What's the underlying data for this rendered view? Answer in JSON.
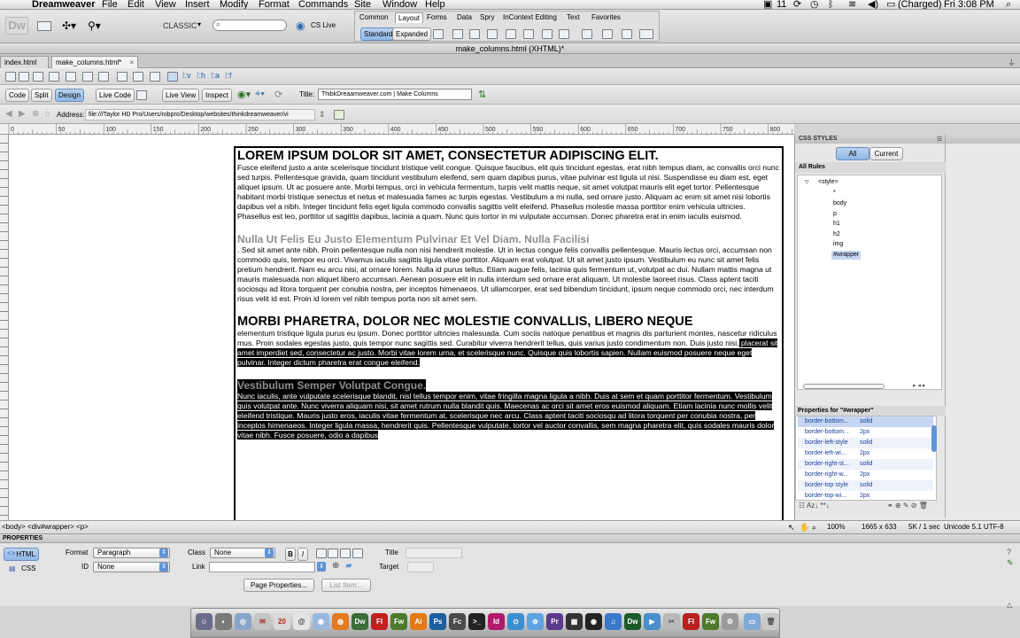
{
  "menubar": {
    "apple": "",
    "app_name": "Dreamweaver",
    "items": [
      "File",
      "Edit",
      "View",
      "Insert",
      "Modify",
      "Format",
      "Commands",
      "Site",
      "Window",
      "Help"
    ],
    "status_num": "11",
    "battery": "(Charged)",
    "clock": "Fri 3:08 PM"
  },
  "appbar": {
    "logo": "Dw",
    "workspace": "CLASSIC",
    "search_placeholder": "",
    "cs_live": "CS Live",
    "insert_tabs": [
      "Common",
      "Layout",
      "Forms",
      "Data",
      "Spry",
      "InContext Editing",
      "Text",
      "Favorites"
    ],
    "active_insert_tab": "Layout",
    "layout_modes": [
      "Standard",
      "Expanded"
    ]
  },
  "window_title": "make_columns.html (XHTML)*",
  "doc_tabs": [
    "index.html",
    "make_columns.html*"
  ],
  "doc_tab_close": "×",
  "view_buttons": [
    "Code",
    "Split",
    "Design"
  ],
  "live_code": "Live Code",
  "live_view": "Live View",
  "inspect": "Inspect",
  "title_label": "Title:",
  "title_value": "ThibkDreaamweaver.com | Make Columns",
  "address_label": "Address:",
  "address_value": "file:///Taylor HD Pro/Users/robpro/Desktop/websites/thinkdreamweaver/vi",
  "ruler_labels": [
    "0",
    "50",
    "100",
    "150",
    "200",
    "250",
    "300",
    "350",
    "400",
    "450",
    "500",
    "550",
    "600",
    "650",
    "700",
    "750",
    "800",
    "850"
  ],
  "content": {
    "h1a": "LOREM IPSUM DOLOR SIT AMET, CONSECTETUR ADIPISCING ELIT.",
    "p1": "Fusce eleifend justo a ante scelerisque tincidunt tristique velit congue. Quisque faucibus, elit quis tincidunt egestas, erat nibh tempus diam, ac convallis orci nunc sed turpis. Pellentesque gravida, quam tincidunt vestibulum eleifend, sem quam dapibus purus, vitae pulvinar est ligula ut nisi. Suspendisse eu diam est, eget aliquet ipsum. Ut ac posuere ante. Morbi tempus, orci in vehicula fermentum, turpis velit mattis neque, sit amet volutpat mauris elit eget tortor. Pellentesque habitant morbi tristique senectus et netus et malesuada fames ac turpis egestas. Vestibulum a mi nulla, sed ornare justo. Aliquam ac enim sit amet nisi lobortis dapibus vel a nibh. Integer tincidunt felis eget ligula commodo convallis sagittis velit eleifend. Phasellus molestie massa porttitor enim vehicula ultricies. Phasellus est leo, porttitor ut sagittis dapibus, lacinia a quam. Nunc quis tortor in mi vulputate accumsan. Donec pharetra erat in enim iaculis euismod.",
    "h2a": "Nulla Ut Felis Eu Justo Elementum Pulvinar Et Vel Diam. Nulla Facilisi",
    "p2": ". Sed sit amet ante nibh. Proin pellentesque nulla non nisi hendrerit molestie. Ut in lectus congue felis convallis pellentesque. Mauris lectus orci, accumsan non commodo quis, tempor eu orci. Vivamus iaculis sagittis ligula vitae porttitor. Aliquam erat volutpat. Ut sit amet justo ipsum. Vestibulum eu nunc sit amet felis pretium hendrerit. Nam eu arcu nisi, at ornare lorem. Nulla id purus tellus. Etiam augue felis, lacinia quis fermentum ut, volutpat ac dui. Nullam mattis magna ut mauris malesuada non aliquet libero accumsan. Aenean posuere elit in nulla interdum sed ornare erat aliquam. Ut molestie laoreet risus. Class aptent taciti sociosqu ad litora torquent per conubia nostra, per inceptos himenaeos. Ut ullamcorper, erat sed bibendum tincidunt, ipsum neque commodo orci, nec interdum risus velit id est. Proin id lorem vel nibh tempus porta non sit amet sem.",
    "h1b": "MORBI PHARETRA, DOLOR NEC MOLESTIE CONVALLIS, LIBERO NEQUE",
    "p3a": "elementum tristique ligula purus eu ipsum. Donec porttitor ultricies malesuada. Cum sociis natoque penatibus et magnis dis parturient montes, nascetur ridiculus mus. Proin sodales egestas justo, quis tempor nunc sagittis sed. Curabitur viverra hendrerit tellus, quis varius justo condimentum non. Duis justo nisi,",
    "p3b": " placerat sit amet imperdiet sed, consectetur ac justo. Morbi vitae lorem urna, et scelerisque nunc. Quisque quis lobortis sapien. Nullam euismod posuere neque eget pulvinar. Integer dictum pharetra erat congue eleifend.",
    "h2b": "Vestibulum Semper Volutpat Congue.",
    "p4": "Nunc iaculis, ante vulputate scelerisque blandit, nisl tellus tempor enim, vitae fringilla magna ligula a nibh. Duis at sem et quam porttitor fermentum. Vestibulum quis volutpat ante. Nunc viverra aliquam nisi, sit amet rutrum nulla blandit quis. Maecenas ac orci sit amet eros euismod aliquam. Etiam lacinia nunc mollis velit eleifend tristique. Mauris justo eros, iaculis vitae fermentum at, scelerisque nec arcu. Class aptent taciti sociosqu ad litora torquent per conubia nostra, per inceptos himenaeos. Integer ligula massa, hendrerit quis. Pellentesque vulputate, tortor vel auctor convallis, sem magna pharetra elit, quis sodales mauris dolor vitae nibh. Fusce posuere, odio a dapibus"
  },
  "css_panel": {
    "title": "CSS STYLES",
    "mode_all": "All",
    "mode_current": "Current",
    "all_rules": "All Rules",
    "rules": [
      "<style>",
      "*",
      "body",
      "p",
      "h1",
      "h2",
      "img",
      "#wrapper"
    ],
    "selected_rule": "#wrapper",
    "props_title": "Properties for \"#wrapper\"",
    "properties": [
      {
        "name": "border-bottom...",
        "value": "solid"
      },
      {
        "name": "border-bottom...",
        "value": "2px"
      },
      {
        "name": "border-left-style",
        "value": "solid"
      },
      {
        "name": "border-left-wi...",
        "value": "2px"
      },
      {
        "name": "border-right-st...",
        "value": "solid"
      },
      {
        "name": "border-right-w...",
        "value": "2px"
      },
      {
        "name": "border-top-style",
        "value": "solid"
      },
      {
        "name": "border-top-wi...",
        "value": "2px"
      }
    ]
  },
  "status": {
    "tags": "<body> <div#wrapper> <p>",
    "zoom": "100%",
    "size": "1665 x 633",
    "download": "5K / 1 sec",
    "encoding": "Unicode 5.1 UTF-8"
  },
  "properties": {
    "title": "PROPERTIES",
    "html_btn": "HTML",
    "css_btn": "CSS",
    "format_label": "Format",
    "format_value": "Paragraph",
    "class_label": "Class",
    "class_value": "None",
    "id_label": "ID",
    "id_value": "None",
    "link_label": "Link",
    "title_label": "Title",
    "target_label": "Target",
    "bold": "B",
    "italic": "I",
    "page_props": "Page Properties...",
    "list_item": "List Item..."
  },
  "dock_apps": [
    "Fl",
    "Fw",
    "Ai",
    "Ps",
    "Fc",
    "Id",
    "Pr",
    "Dw",
    "Fl",
    "Fw"
  ],
  "colors": {
    "selection": "#000000",
    "accent": "#3d82d6",
    "link_blue": "#1c3e9a"
  }
}
